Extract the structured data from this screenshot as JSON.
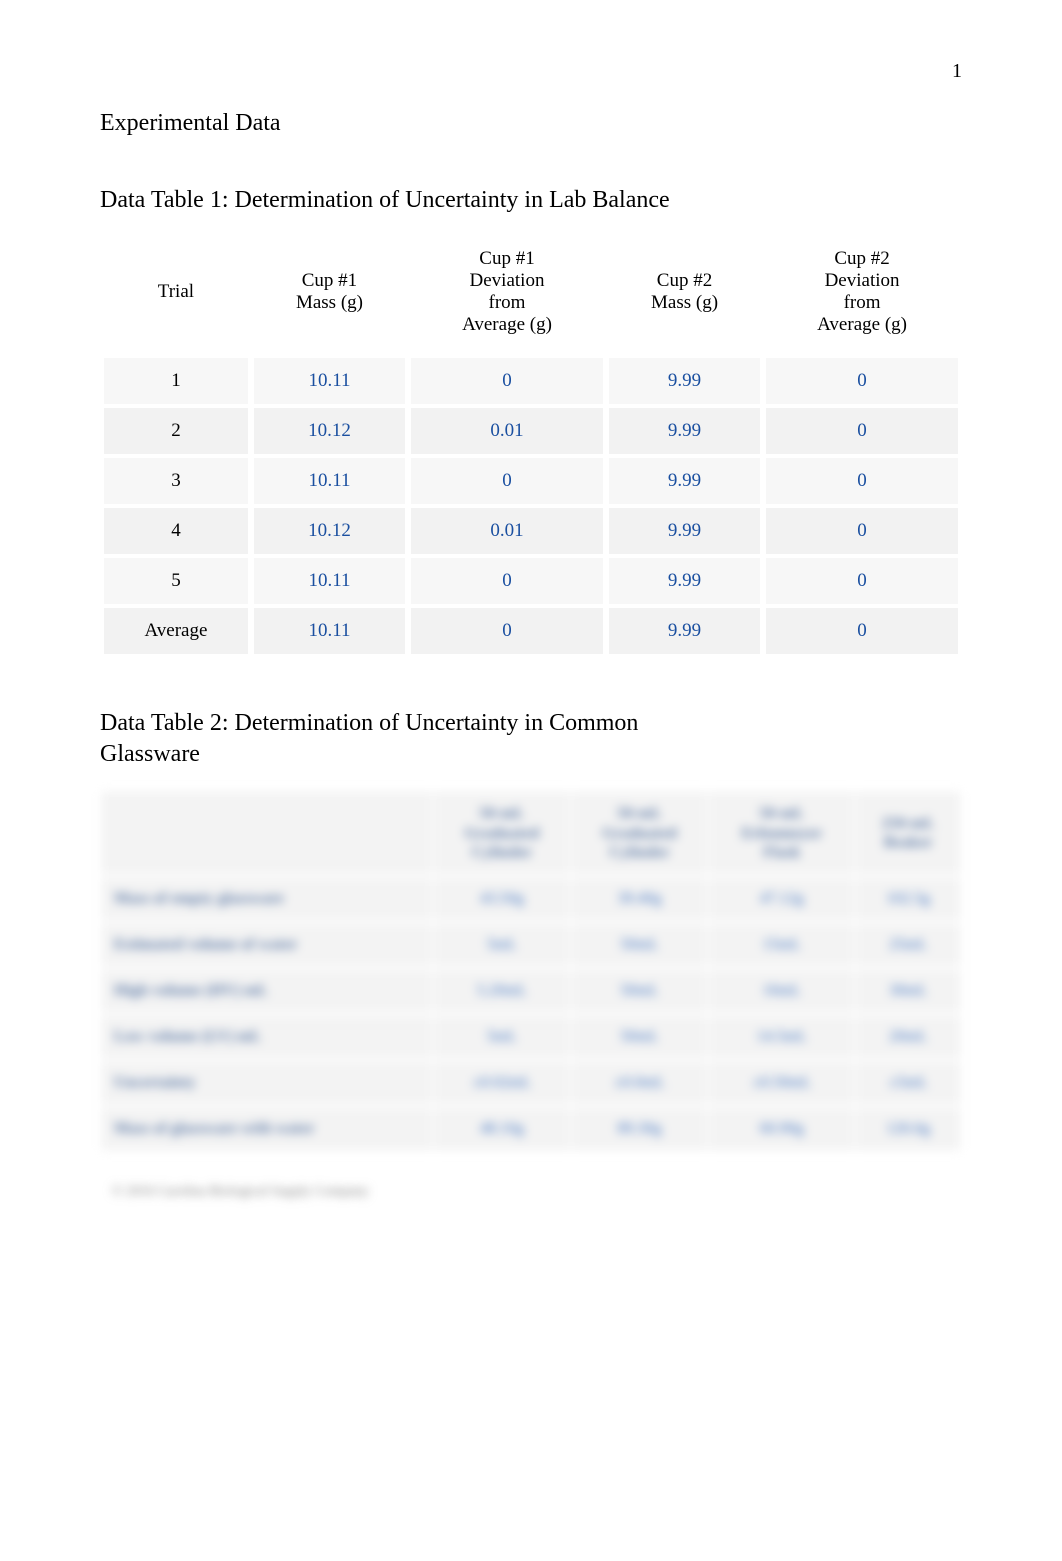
{
  "page_number": "1",
  "title_main": "Experimental Data",
  "table1": {
    "caption": "Data Table 1: Determination of Uncertainty in Lab Balance",
    "headers": {
      "c0": "Trial",
      "c1": "Cup #1\nMass (g)",
      "c2": "Cup #1\nDeviation\nfrom\nAverage (g)",
      "c3": "Cup #2\nMass (g)",
      "c4": "Cup #2\nDeviation\nfrom\nAverage (g)"
    },
    "rows": [
      {
        "label": "1",
        "c1": "10.11",
        "c2": "0",
        "c3": "9.99",
        "c4": "0"
      },
      {
        "label": "2",
        "c1": "10.12",
        "c2": "0.01",
        "c3": "9.99",
        "c4": "0"
      },
      {
        "label": "3",
        "c1": "10.11",
        "c2": "0",
        "c3": "9.99",
        "c4": "0"
      },
      {
        "label": "4",
        "c1": "10.12",
        "c2": "0.01",
        "c3": "9.99",
        "c4": "0"
      },
      {
        "label": "5",
        "c1": "10.11",
        "c2": "0",
        "c3": "9.99",
        "c4": "0"
      },
      {
        "label": "Average",
        "c1": "10.11",
        "c2": "0",
        "c3": "9.99",
        "c4": "0"
      }
    ]
  },
  "table2": {
    "caption": "Data Table 2: Determination of Uncertainty in Common Glassware",
    "headers": {
      "c0": "",
      "c1": "50-mL\nGraduated\nCylinder",
      "c2": "50-mL\nGraduated\nCylinder",
      "c3": "50-mL\nErlenmeyer\nFlask",
      "c4": "250-mL\nBeaker"
    },
    "rows": [
      {
        "label": "Mass of empty glassware",
        "c1": "43.50g",
        "c2": "39.40g",
        "c3": "47.12g",
        "c4": "102.5g"
      },
      {
        "label": "Estimated volume of water",
        "c1": "5mL",
        "c2": "50mL",
        "c3": "15mL",
        "c4": "25mL"
      },
      {
        "label": "High volume (HV) mL",
        "c1": "5.20mL",
        "c2": "50mL",
        "c3": "16mL",
        "c4": "30mL"
      },
      {
        "label": "Low volume (LV) mL",
        "c1": "5mL",
        "c2": "50mL",
        "c3": "14.5mL",
        "c4": "20mL"
      },
      {
        "label": "Uncertainty",
        "c1": "±0.02mL",
        "c2": "±0.0mL",
        "c3": "±0.50mL",
        "c4": "±5mL"
      },
      {
        "label": "Mass of glassware with water",
        "c1": "48.10g",
        "c2": "89.30g",
        "c3": "60.90g",
        "c4": "126.6g"
      }
    ]
  },
  "footnote_text": "© 2016 Carolina Biological Supply Company"
}
